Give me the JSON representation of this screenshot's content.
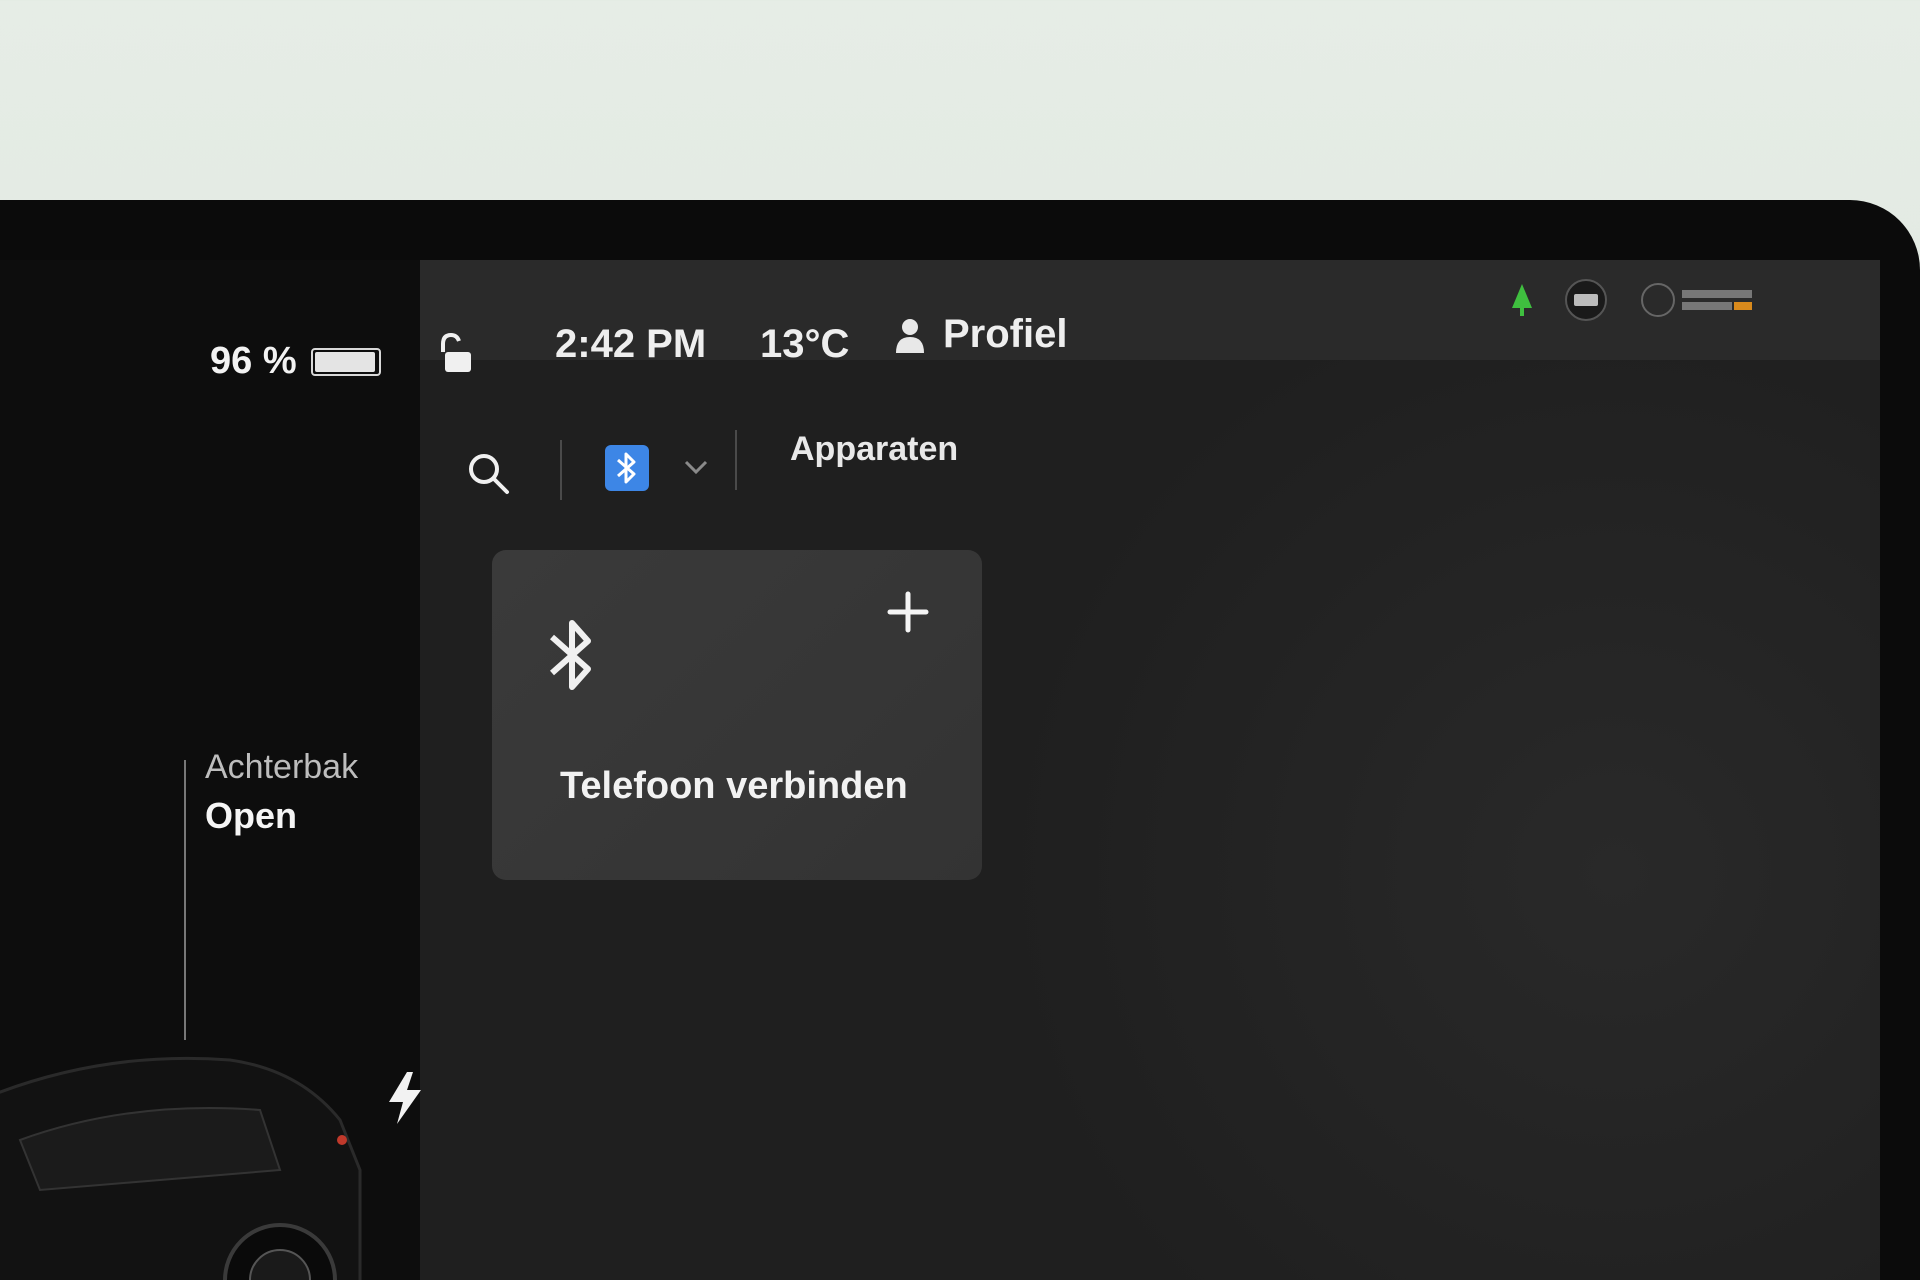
{
  "status": {
    "battery_percent_label": "96 %",
    "battery_level": 0.96,
    "time": "2:42 PM",
    "temperature": "13°C",
    "profile_label": "Profiel"
  },
  "vehicle": {
    "trunk_label": "Achterbak",
    "trunk_state": "Open"
  },
  "toolbar": {
    "search_icon": "search-icon",
    "bluetooth_icon": "bluetooth-icon",
    "dropdown_icon": "chevron-down-icon",
    "devices_label": "Apparaten"
  },
  "card": {
    "icon": "bluetooth-icon",
    "add_icon": "plus-icon",
    "label": "Telefoon verbinden"
  },
  "colors": {
    "accent_bluetooth": "#3d86e6",
    "screen_bg": "#1f1f1f",
    "card_bg": "#383838",
    "text_primary": "#eeeeee"
  }
}
